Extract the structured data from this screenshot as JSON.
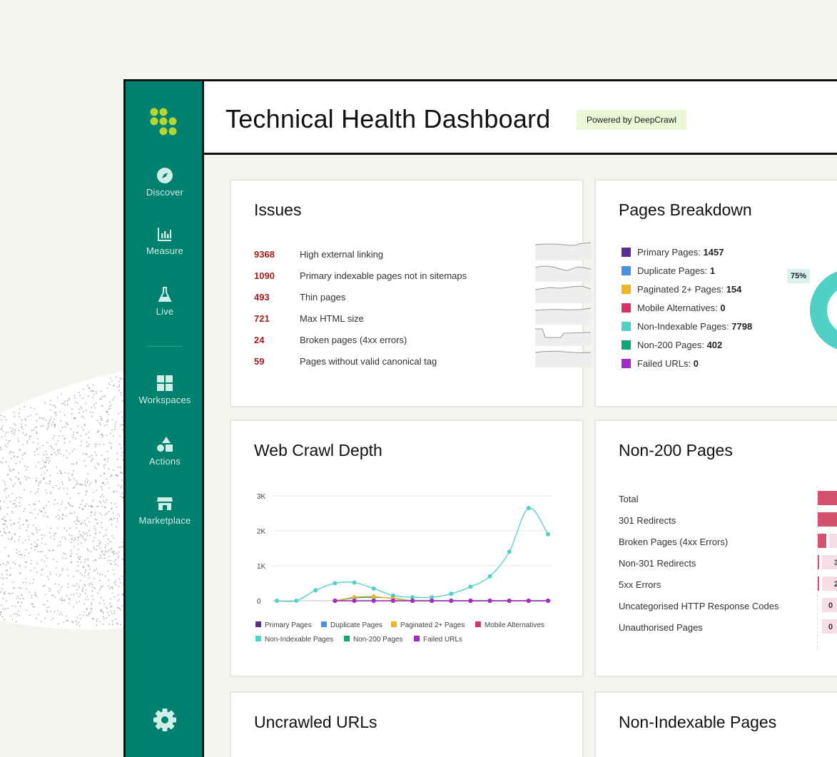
{
  "app": {
    "title": "Technical Health Dashboard",
    "powered_badge": "Powered by DeepCrawl",
    "accent": "#00806e",
    "logo_color": "#b6d531"
  },
  "sidebar": {
    "items": [
      {
        "label": "Discover",
        "icon": "compass-icon"
      },
      {
        "label": "Measure",
        "icon": "bar-chart-icon"
      },
      {
        "label": "Live",
        "icon": "flask-icon"
      },
      {
        "label": "Workspaces",
        "icon": "grid-icon"
      },
      {
        "label": "Actions",
        "icon": "shapes-icon"
      },
      {
        "label": "Marketplace",
        "icon": "store-icon"
      }
    ],
    "settings_icon": "gear-icon"
  },
  "issues": {
    "title": "Issues",
    "rows": [
      {
        "count": "9368",
        "label": "High external linking"
      },
      {
        "count": "1090",
        "label": "Primary indexable pages not in sitemaps"
      },
      {
        "count": "493",
        "label": "Thin pages"
      },
      {
        "count": "721",
        "label": "Max HTML size"
      },
      {
        "count": "24",
        "label": "Broken pages (4xx errors)"
      },
      {
        "count": "59",
        "label": "Pages without valid canonical tag"
      }
    ]
  },
  "pages_breakdown": {
    "title": "Pages Breakdown",
    "items": [
      {
        "label": "Primary Pages:",
        "value": "1457",
        "color": "#5a2d91"
      },
      {
        "label": "Duplicate Pages:",
        "value": "1",
        "color": "#4a90e2"
      },
      {
        "label": "Paginated 2+ Pages:",
        "value": "154",
        "color": "#f0b429"
      },
      {
        "label": "Mobile Alternatives:",
        "value": "0",
        "color": "#d6336c"
      },
      {
        "label": "Non-Indexable Pages:",
        "value": "7798",
        "color": "#4fd1c5"
      },
      {
        "label": "Non-200 Pages:",
        "value": "402",
        "color": "#0fa47a"
      },
      {
        "label": "Failed URLs:",
        "value": "0",
        "color": "#a32cc4"
      }
    ],
    "donut_label": "75%"
  },
  "web_crawl_depth": {
    "title": "Web Crawl Depth"
  },
  "chart_data": {
    "type": "line",
    "x": [
      1,
      2,
      3,
      4,
      5,
      6,
      7,
      8,
      9,
      10,
      11,
      12,
      13,
      14,
      15
    ],
    "ylim": [
      0,
      3000
    ],
    "y_ticks": [
      "0",
      "1K",
      "2K",
      "3K"
    ],
    "grid": true,
    "legend_position": "bottom",
    "series": [
      {
        "name": "Primary Pages",
        "color": "#5a2d91",
        "values": [
          null,
          null,
          null,
          0,
          0,
          0,
          0,
          0,
          0,
          0,
          0,
          0,
          0,
          0,
          0
        ]
      },
      {
        "name": "Duplicate Pages",
        "color": "#4a90e2",
        "values": [
          null,
          null,
          null,
          0,
          0,
          0,
          0,
          0,
          0,
          0,
          0,
          0,
          0,
          0,
          0
        ]
      },
      {
        "name": "Paginated 2+ Pages",
        "color": "#f0b429",
        "values": [
          null,
          null,
          null,
          0,
          100,
          120,
          60,
          0,
          0,
          0,
          0,
          0,
          0,
          0,
          0
        ]
      },
      {
        "name": "Mobile Alternatives",
        "color": "#d6336c",
        "values": [
          null,
          null,
          null,
          0,
          0,
          0,
          0,
          0,
          0,
          0,
          0,
          0,
          0,
          0,
          0
        ]
      },
      {
        "name": "Non-Indexable Pages",
        "color": "#4fd1c5",
        "values": [
          0,
          0,
          300,
          500,
          520,
          350,
          150,
          100,
          100,
          200,
          400,
          700,
          1400,
          2650,
          1900
        ]
      },
      {
        "name": "Non-200 Pages",
        "color": "#0fa47a",
        "values": [
          null,
          null,
          null,
          0,
          80,
          100,
          70,
          0,
          0,
          0,
          0,
          0,
          0,
          0,
          0
        ]
      },
      {
        "name": "Failed URLs",
        "color": "#a32cc4",
        "values": [
          null,
          null,
          null,
          0,
          0,
          0,
          0,
          0,
          0,
          0,
          0,
          0,
          0,
          0,
          0
        ]
      }
    ]
  },
  "non200": {
    "title": "Non-200 Pages",
    "rows": [
      {
        "label": "Total",
        "value": ""
      },
      {
        "label": "301 Redirects",
        "value": ""
      },
      {
        "label": "Broken Pages (4xx Errors)",
        "value": ""
      },
      {
        "label": "Non-301 Redirects",
        "value": "3"
      },
      {
        "label": "5xx Errors",
        "value": "2"
      },
      {
        "label": "Uncategorised HTTP Response Codes",
        "value": "0"
      },
      {
        "label": "Unauthorised Pages",
        "value": "0"
      }
    ],
    "bar_color": "#d6506f",
    "bar_light": "#f6dde3"
  },
  "uncrawled": {
    "title": "Uncrawled URLs"
  },
  "non_indexable": {
    "title": "Non-Indexable Pages"
  }
}
